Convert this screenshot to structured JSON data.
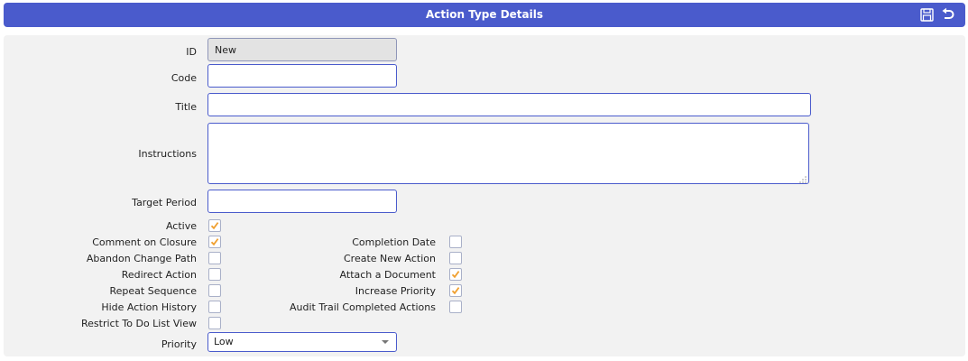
{
  "header": {
    "title": "Action Type Details"
  },
  "form": {
    "id": {
      "label": "ID",
      "value": "New"
    },
    "code": {
      "label": "Code",
      "value": ""
    },
    "title": {
      "label": "Title",
      "value": ""
    },
    "instructions": {
      "label": "Instructions",
      "value": ""
    },
    "target_period": {
      "label": "Target Period",
      "value": ""
    },
    "left_checks": [
      {
        "label": "Active",
        "checked": true
      },
      {
        "label": "Comment on Closure",
        "checked": true
      },
      {
        "label": "Abandon Change Path",
        "checked": false
      },
      {
        "label": "Redirect Action",
        "checked": false
      },
      {
        "label": "Repeat Sequence",
        "checked": false
      },
      {
        "label": "Hide Action History",
        "checked": false
      },
      {
        "label": "Restrict To Do List View",
        "checked": false
      }
    ],
    "right_checks": [
      {
        "label": "Completion Date",
        "checked": false
      },
      {
        "label": "Create New Action",
        "checked": false
      },
      {
        "label": "Attach a Document",
        "checked": true
      },
      {
        "label": "Increase Priority",
        "checked": true
      },
      {
        "label": "Audit Trail Completed Actions",
        "checked": false
      }
    ],
    "priority": {
      "label": "Priority",
      "value": "Low"
    }
  },
  "icons": {
    "save": "save-icon",
    "undo": "undo-icon"
  },
  "colors": {
    "accent": "#4a5bcc",
    "check": "#f0a030",
    "panel": "#f2f2f2"
  }
}
